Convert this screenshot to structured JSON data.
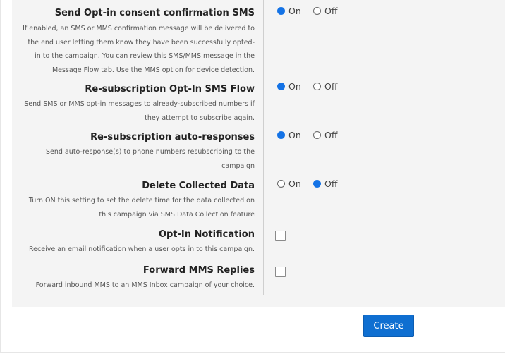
{
  "settings": [
    {
      "title": "Send Opt-in consent confirmation SMS",
      "description": "If enabled, an SMS or MMS confirmation message will be delivered to the end user letting them know they have been successfully opted-in to the campaign. You can review this SMS/MMS message in the Message Flow tab. Use the MMS option for device detection.",
      "on_label": "On",
      "off_label": "Off",
      "selected": "On"
    },
    {
      "title": "Re-subscription Opt-In SMS Flow",
      "description": "Send SMS or MMS opt-in messages to already-subscribed numbers if they attempt to subscribe again.",
      "on_label": "On",
      "off_label": "Off",
      "selected": "On"
    },
    {
      "title": "Re-subscription auto-responses",
      "description": "Send auto-response(s) to phone numbers resubscribing to the campaign",
      "on_label": "On",
      "off_label": "Off",
      "selected": "On"
    },
    {
      "title": "Delete Collected Data",
      "description": "Turn ON this setting to set the delete time for the data collected on this campaign via SMS Data Collection feature",
      "on_label": "On",
      "off_label": "Off",
      "selected": "Off"
    },
    {
      "title": "Opt-In Notification",
      "description": "Receive an email notification when a user opts in to this campaign.",
      "checked": false
    },
    {
      "title": "Forward MMS Replies",
      "description": "Forward inbound MMS to an MMS Inbox campaign of your choice.",
      "checked": false
    }
  ],
  "create_button": "Create",
  "colors": {
    "accent": "#1473e6",
    "button": "#0f6fd1",
    "panel": "#f4f4f4"
  }
}
